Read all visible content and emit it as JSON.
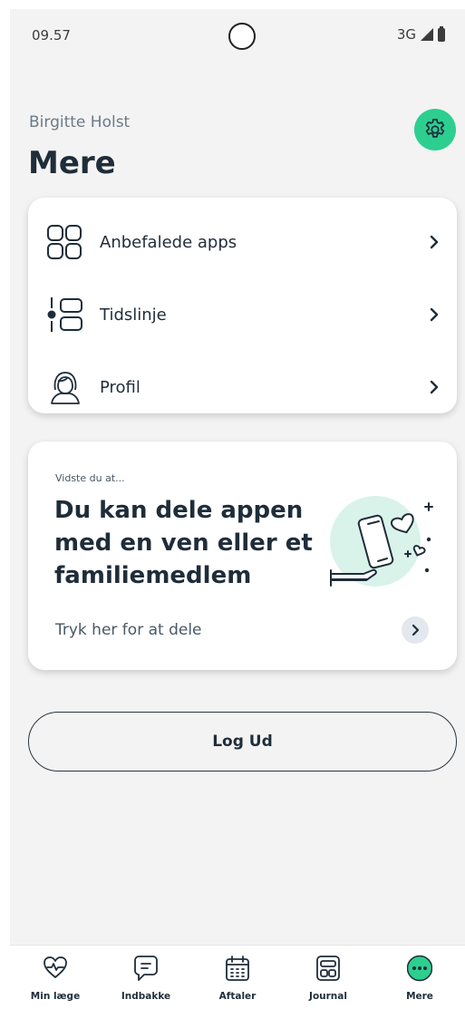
{
  "status_bar": {
    "time": "09.57",
    "network": "3G"
  },
  "header": {
    "user_name": "Birgitte Holst",
    "title": "Mere"
  },
  "menu": {
    "items": [
      {
        "label": "Anbefalede apps",
        "icon": "apps-grid-icon"
      },
      {
        "label": "Tidslinje",
        "icon": "timeline-icon"
      },
      {
        "label": "Profil",
        "icon": "person-icon"
      }
    ]
  },
  "promo": {
    "eyebrow": "Vidste du at...",
    "heading": "Du kan dele appen med en ven eller et familiemedlem",
    "link": "Tryk her for at dele"
  },
  "logout": {
    "label": "Log Ud"
  },
  "tabs": [
    {
      "label": "Min læge",
      "icon": "heart-pulse-icon",
      "active": false
    },
    {
      "label": "Indbakke",
      "icon": "message-icon",
      "active": false
    },
    {
      "label": "Aftaler",
      "icon": "calendar-icon",
      "active": false
    },
    {
      "label": "Journal",
      "icon": "journal-icon",
      "active": false
    },
    {
      "label": "Mere",
      "icon": "more-dots-icon",
      "active": true
    }
  ],
  "colors": {
    "accent": "#2ccf8f",
    "text": "#1f2d3a",
    "background": "#f3f3f3",
    "illustration_bg": "#d9f3ea"
  }
}
